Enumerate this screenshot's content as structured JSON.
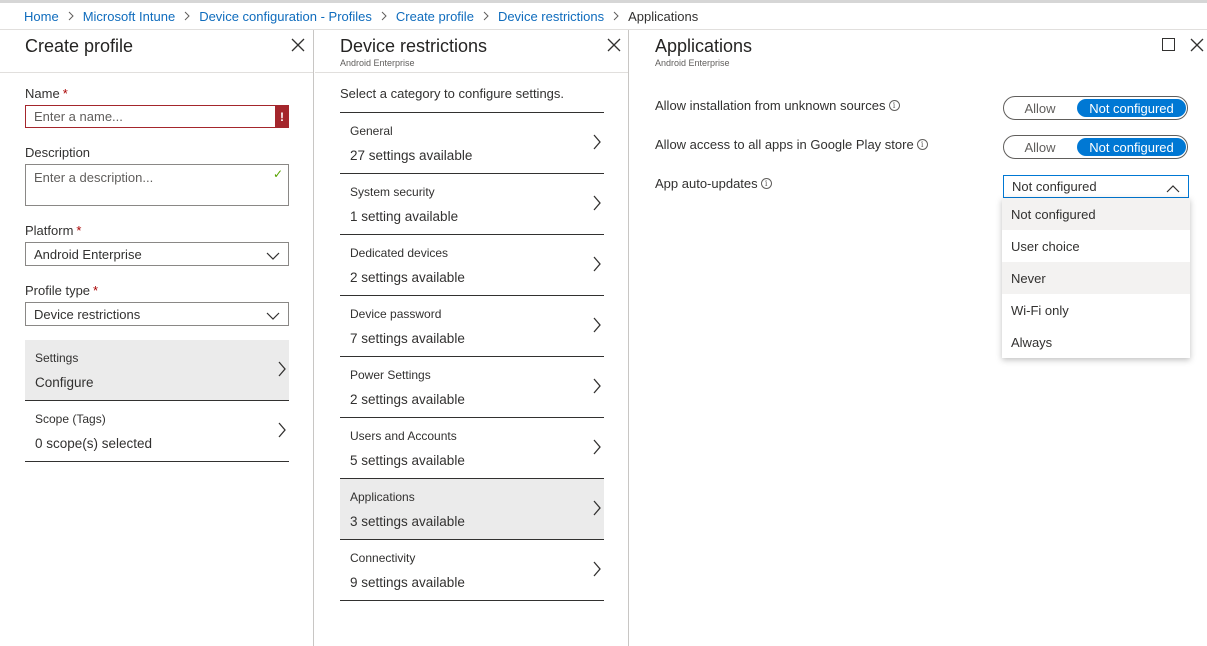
{
  "breadcrumb": [
    "Home",
    "Microsoft Intune",
    "Device configuration - Profiles",
    "Create profile",
    "Device restrictions",
    "Applications"
  ],
  "create_profile": {
    "title": "Create profile",
    "name_label": "Name",
    "name_placeholder": "Enter a name...",
    "description_label": "Description",
    "description_placeholder": "Enter a description...",
    "platform_label": "Platform",
    "platform_value": "Android Enterprise",
    "profile_type_label": "Profile type",
    "profile_type_value": "Device restrictions",
    "rows": [
      {
        "title": "Settings",
        "value": "Configure"
      },
      {
        "title": "Scope (Tags)",
        "value": "0 scope(s) selected"
      }
    ]
  },
  "device_restrictions": {
    "title": "Device restrictions",
    "subtitle": "Android Enterprise",
    "hint": "Select a category to configure settings.",
    "categories": [
      {
        "title": "General",
        "value": "27 settings available"
      },
      {
        "title": "System security",
        "value": "1 setting available"
      },
      {
        "title": "Dedicated devices",
        "value": "2 settings available"
      },
      {
        "title": "Device password",
        "value": "7 settings available"
      },
      {
        "title": "Power Settings",
        "value": "2 settings available"
      },
      {
        "title": "Users and Accounts",
        "value": "5 settings available"
      },
      {
        "title": "Applications",
        "value": "3 settings available"
      },
      {
        "title": "Connectivity",
        "value": "9 settings available"
      }
    ]
  },
  "applications": {
    "title": "Applications",
    "subtitle": "Android Enterprise",
    "settings": [
      {
        "label": "Allow installation from unknown sources",
        "allow": "Allow",
        "not_configured": "Not configured"
      },
      {
        "label": "Allow access to all apps in Google Play store",
        "allow": "Allow",
        "not_configured": "Not configured"
      }
    ],
    "auto_updates": {
      "label": "App auto-updates",
      "selected": "Not configured",
      "options": [
        "Not configured",
        "User choice",
        "Never",
        "Wi-Fi only",
        "Always"
      ]
    }
  },
  "colors": {
    "accent": "#0078d4",
    "link": "#0f6cbd",
    "error": "#a4262c",
    "selected_row": "#ebebeb"
  }
}
